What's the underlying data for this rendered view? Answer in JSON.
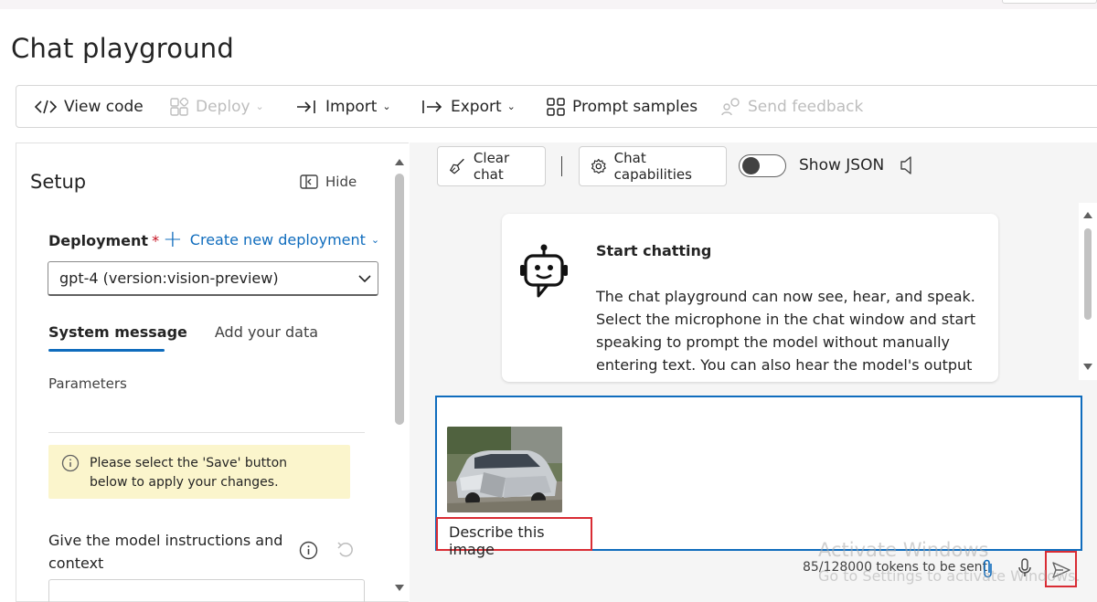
{
  "page": {
    "title": "Chat playground"
  },
  "toolbar": {
    "view_code": "View code",
    "deploy": "Deploy",
    "import": "Import",
    "export": "Export",
    "prompt_samples": "Prompt samples",
    "send_feedback": "Send feedback"
  },
  "setup": {
    "title": "Setup",
    "hide_label": "Hide",
    "deployment_label": "Deployment",
    "required_mark": "*",
    "create_deployment": "Create new deployment",
    "deployment_value": "gpt-4 (version:vision-preview)",
    "tabs": [
      {
        "label": "System message",
        "active": true
      },
      {
        "label": "Add your data",
        "active": false
      }
    ],
    "parameters_label": "Parameters",
    "notice_text": "Please select the 'Save' button below to apply your changes.",
    "instructions_label": "Give the model instructions and context"
  },
  "chat": {
    "clear_chat": "Clear chat",
    "chat_capabilities": "Chat capabilities",
    "show_json": "Show JSON",
    "show_json_on": false,
    "card_title": "Start chatting",
    "card_body": "The chat playground can now see, hear, and speak. Select the microphone in the chat window and start speaking to prompt the model without manually entering text. You can also hear the model's output",
    "prompt_text": "Describe this image",
    "token_count": "85/128000 tokens to be sent"
  },
  "watermark": {
    "line1": "Activate Windows",
    "line2": "Go to Settings to activate Windows."
  },
  "colors": {
    "accent": "#0f6cbd",
    "highlight_red": "#d92c34",
    "notice_bg": "#fbf5cc",
    "chat_bg": "#f5f5f5"
  }
}
